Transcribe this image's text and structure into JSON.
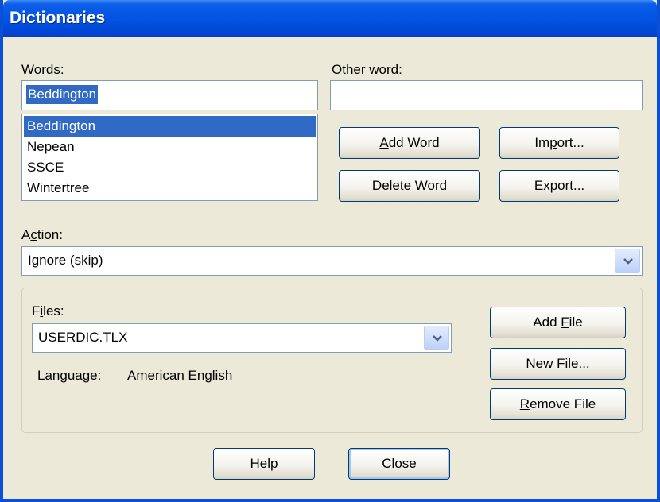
{
  "window": {
    "title": "Dictionaries"
  },
  "words": {
    "label": "Words:",
    "label_mnemonic": "W",
    "label_rest": "ords:",
    "input_value": "Beddington",
    "list": [
      "Beddington",
      "Nepean",
      "SSCE",
      "Wintertree"
    ],
    "selected_index": 0
  },
  "other_word": {
    "label": "Other word:",
    "label_mnemonic": "O",
    "label_rest": "ther word:",
    "input_value": ""
  },
  "buttons": {
    "add_word": {
      "pre": "",
      "mnemonic": "A",
      "post": "dd Word"
    },
    "delete_word": {
      "pre": "",
      "mnemonic": "D",
      "post": "elete Word"
    },
    "import": {
      "pre": "Im",
      "mnemonic": "p",
      "post": "ort..."
    },
    "export": {
      "pre": "",
      "mnemonic": "E",
      "post": "xport..."
    },
    "add_file": {
      "pre": "Add ",
      "mnemonic": "F",
      "post": "ile"
    },
    "new_file": {
      "pre": "",
      "mnemonic": "N",
      "post": "ew File..."
    },
    "remove_file": {
      "pre": "",
      "mnemonic": "R",
      "post": "emove File"
    },
    "help": {
      "pre": "",
      "mnemonic": "H",
      "post": "elp"
    },
    "close": {
      "pre": "Cl",
      "mnemonic": "o",
      "post": "se"
    }
  },
  "action": {
    "label_pre": "A",
    "label_mnemonic": "c",
    "label_post": "tion:",
    "selected": "Ignore (skip)"
  },
  "files": {
    "label_pre": "F",
    "label_mnemonic": "i",
    "label_post": "les:",
    "selected": "USERDIC.TLX",
    "language_label": "Language:",
    "language_value": "American English"
  },
  "icons": {
    "dropdown": "chevron-down-icon"
  },
  "colors": {
    "title_bar": "#0454e3",
    "selection": "#316ac5",
    "dialog_bg": "#ece9d8"
  }
}
